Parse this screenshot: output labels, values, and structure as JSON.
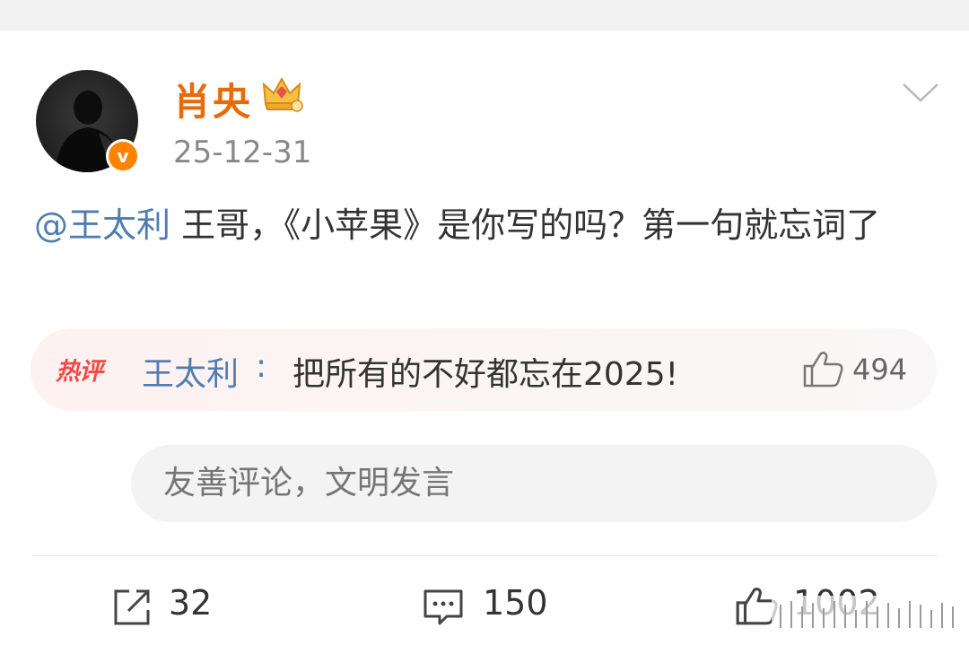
{
  "post": {
    "author": "肖央",
    "date": "25-12-31",
    "mention": "@王太利",
    "text": " 王哥，《小苹果》是你写的吗？第一句就忘词了"
  },
  "hot_comment": {
    "badge": "热评",
    "user": "王太利",
    "colon": ":",
    "text": "把所有的不好都忘在2025!",
    "likes": "494"
  },
  "comment_box": {
    "placeholder": "友善评论，文明发言"
  },
  "actions": {
    "share_count": "32",
    "comment_count": "150",
    "like_count": "1002"
  },
  "colors": {
    "author_name": "#e86b0b",
    "mention": "#507daf",
    "verified_badge": "#ff8200",
    "hot_badge": "#ef4b43"
  },
  "icons": [
    "crown-icon",
    "verified-icon",
    "chevron-down-icon",
    "thumbs-up-icon",
    "share-icon",
    "comment-icon"
  ]
}
